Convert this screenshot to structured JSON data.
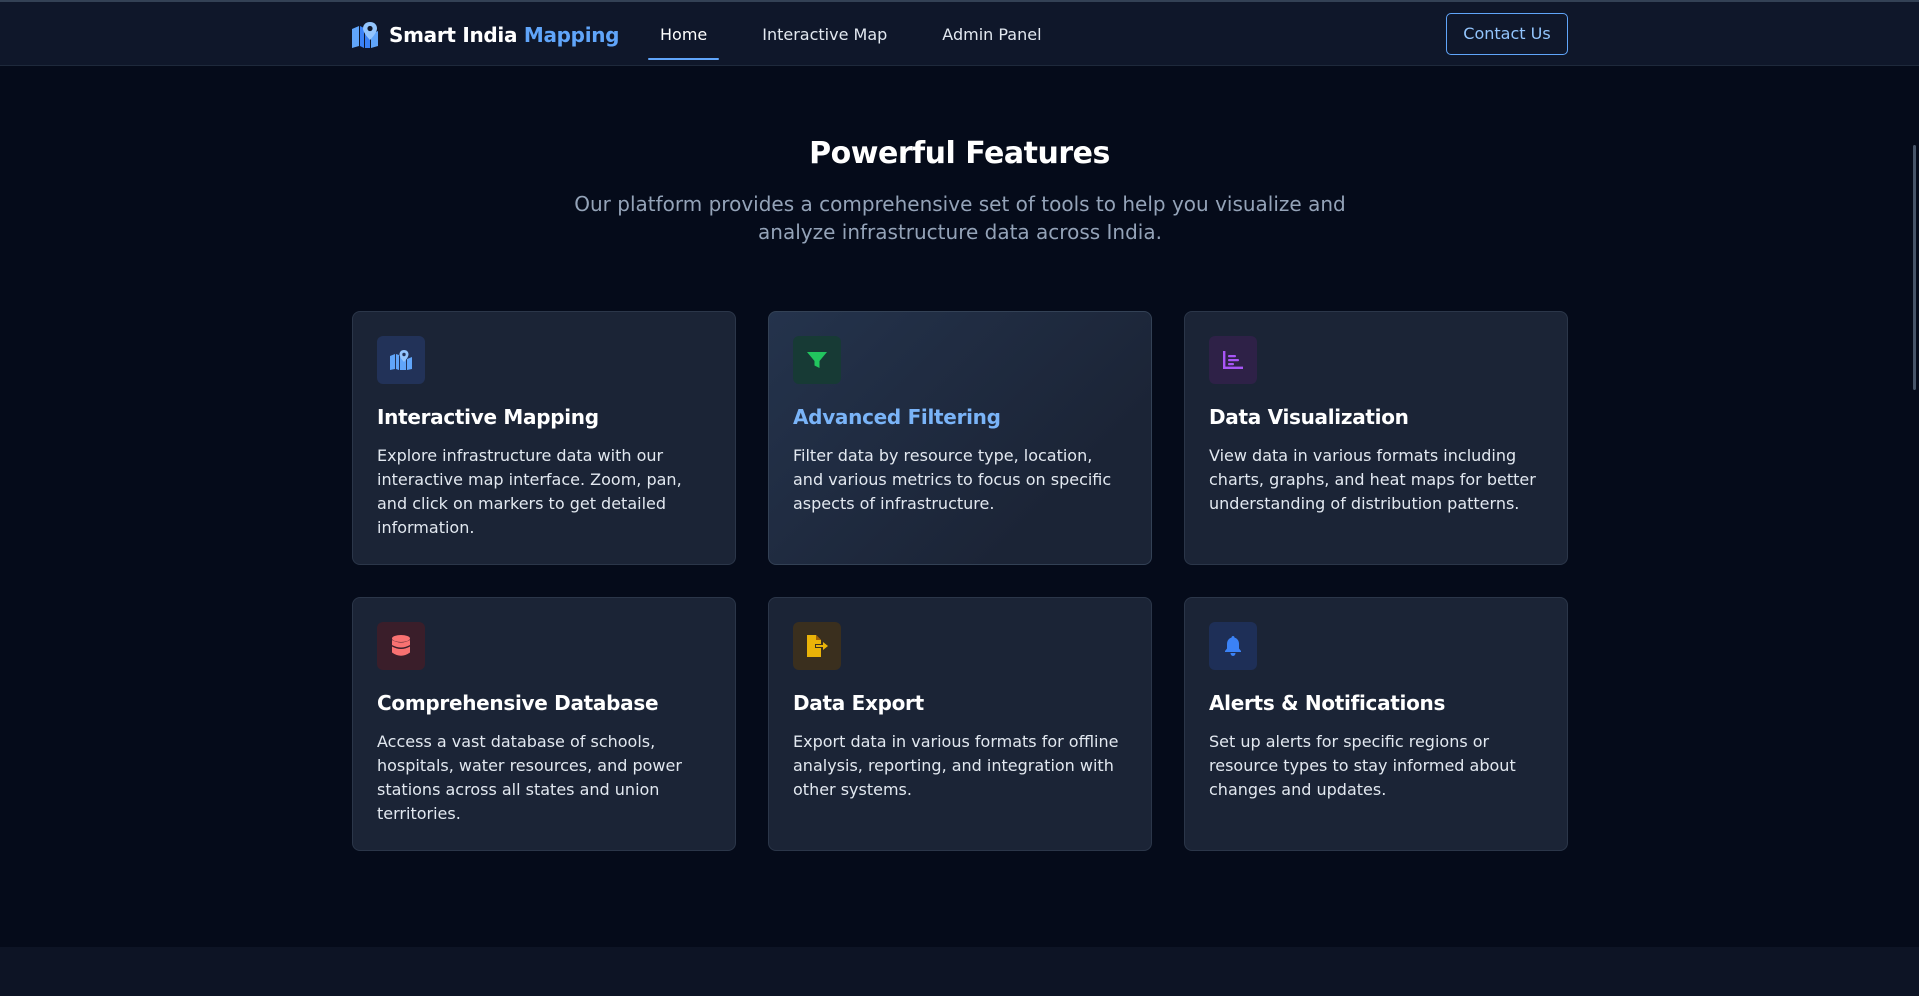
{
  "header": {
    "brand_name": "Smart India",
    "brand_accent": "Mapping",
    "brand_icon": "map-pin-icon",
    "nav": [
      {
        "label": "Home",
        "active": true
      },
      {
        "label": "Interactive Map",
        "active": false
      },
      {
        "label": "Admin Panel",
        "active": false
      }
    ],
    "contact_label": "Contact Us"
  },
  "features": {
    "title": "Powerful Features",
    "subtitle": "Our platform provides a comprehensive set of tools to help you visualize and analyze infrastructure data across India.",
    "cards": [
      {
        "title": "Interactive Mapping",
        "description": "Explore infrastructure data with our interactive map interface. Zoom, pan, and click on markers to get detailed information.",
        "icon": "map-icon",
        "color": "#60a5fa"
      },
      {
        "title": "Advanced Filtering",
        "description": "Filter data by resource type, location, and various metrics to focus on specific aspects of infrastructure.",
        "icon": "filter-icon",
        "color": "#22c55e"
      },
      {
        "title": "Data Visualization",
        "description": "View data in various formats including charts, graphs, and heat maps for better understanding of distribution patterns.",
        "icon": "chart-icon",
        "color": "#a855f7"
      },
      {
        "title": "Comprehensive Database",
        "description": "Access a vast database of schools, hospitals, water resources, and power stations across all states and union territories.",
        "icon": "database-icon",
        "color": "#ef4444"
      },
      {
        "title": "Data Export",
        "description": "Export data in various formats for offline analysis, reporting, and integration with other systems.",
        "icon": "file-export-icon",
        "color": "#eab308"
      },
      {
        "title": "Alerts & Notifications",
        "description": "Set up alerts for specific regions or resource types to stay informed about changes and updates.",
        "icon": "bell-icon",
        "color": "#3b82f6"
      }
    ]
  },
  "colors": {
    "background": "#050b1a",
    "header": "#0f172a",
    "card": "#1b2436",
    "accent": "#60a5fa"
  }
}
